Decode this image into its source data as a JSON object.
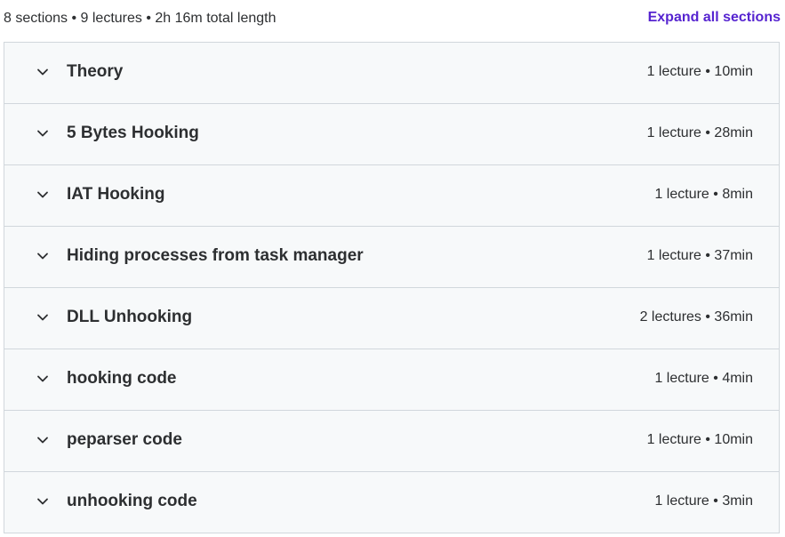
{
  "header": {
    "summary": "8 sections • 9 lectures • 2h 16m total length",
    "expand_all_label": "Expand all sections"
  },
  "sections": [
    {
      "title": "Theory",
      "meta": "1 lecture • 10min",
      "icon": "chevron-down-icon"
    },
    {
      "title": "5 Bytes Hooking",
      "meta": "1 lecture • 28min",
      "icon": "chevron-down-icon"
    },
    {
      "title": "IAT Hooking",
      "meta": "1 lecture • 8min",
      "icon": "chevron-down-icon"
    },
    {
      "title": "Hiding processes from task manager",
      "meta": "1 lecture • 37min",
      "icon": "chevron-down-icon"
    },
    {
      "title": "DLL Unhooking",
      "meta": "2 lectures • 36min",
      "icon": "chevron-down-icon"
    },
    {
      "title": "hooking code",
      "meta": "1 lecture • 4min",
      "icon": "chevron-down-icon"
    },
    {
      "title": "peparser code",
      "meta": "1 lecture • 10min",
      "icon": "chevron-down-icon"
    },
    {
      "title": "unhooking code",
      "meta": "1 lecture • 3min",
      "icon": "chevron-down-icon"
    }
  ],
  "colors": {
    "accent": "#5624d0",
    "text": "#2d2f31",
    "section_bg": "#f7f9fa",
    "border": "#d1d7dc"
  }
}
